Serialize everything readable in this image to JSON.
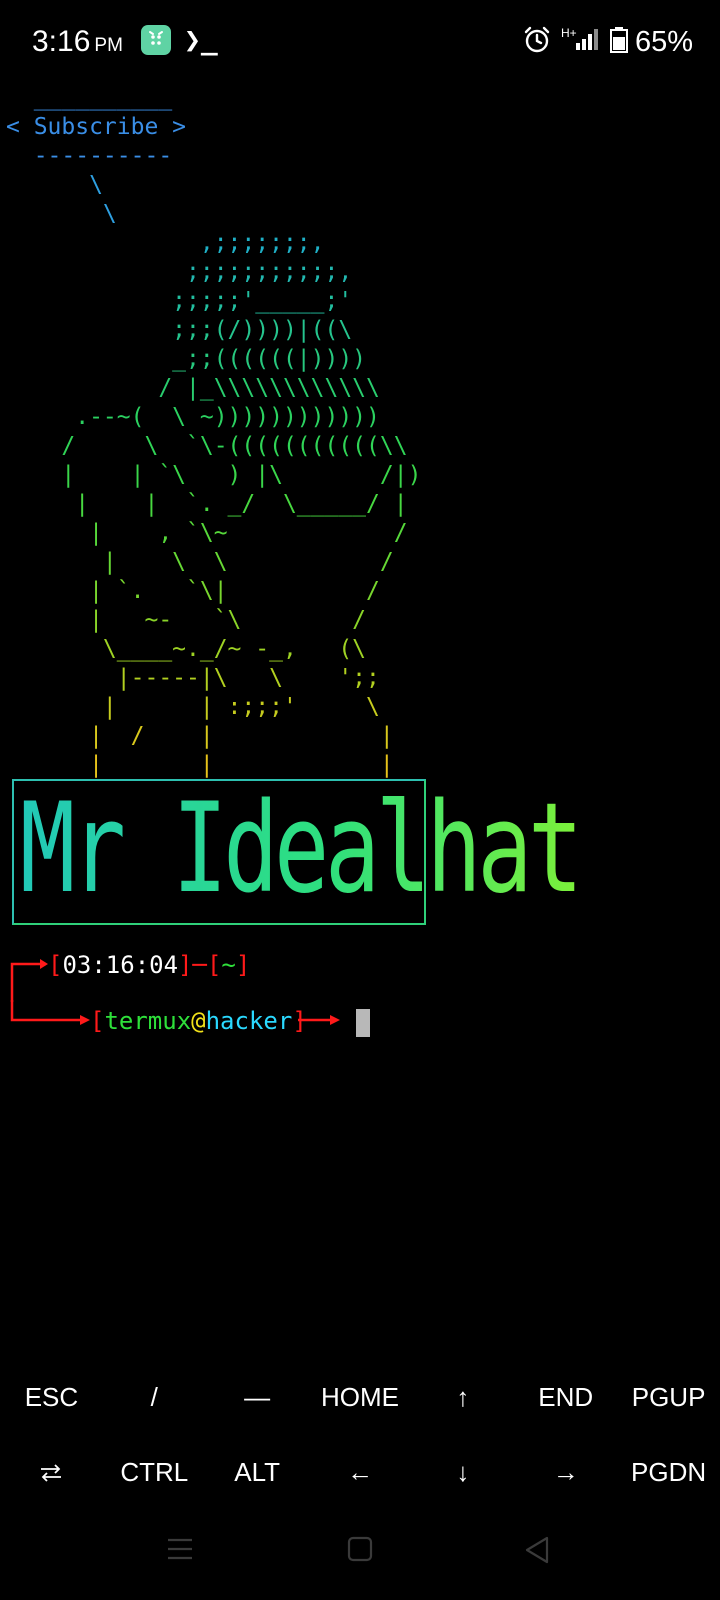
{
  "status_bar": {
    "time": "3:16",
    "ampm": "PM",
    "prompt_glyph": "❯_",
    "network_type": "H+",
    "battery": "65%",
    "icons": [
      "termux-app-icon",
      "terminal-prompt-icon",
      "alarm-icon",
      "signal-icon",
      "battery-icon"
    ]
  },
  "terminal": {
    "ascii_lines": [
      {
        "text": "  __________",
        "color": "#3a8ee6"
      },
      {
        "text": "< Subscribe >",
        "color": "#3a8ee6"
      },
      {
        "text": "  ----------",
        "color": "#3a8ee6"
      },
      {
        "text": "      \\",
        "color": "#2e9fe0"
      },
      {
        "text": "       \\",
        "color": "#2e9fe0"
      },
      {
        "text": "              ,;;;;;;;,",
        "color": "#1fb0c6"
      },
      {
        "text": "             ;;;;;;;;;;;,",
        "color": "#22b8b0"
      },
      {
        "text": "            ;;;;;'_____;'",
        "color": "#22bfa0"
      },
      {
        "text": "            ;;;(/))))|((\\",
        "color": "#25c48e"
      },
      {
        "text": "            _;;((((((|))))",
        "color": "#27c87e"
      },
      {
        "text": "           / |_\\\\\\\\\\\\\\\\\\\\\\\\",
        "color": "#29cd6e"
      },
      {
        "text": "     .--~(  \\ ~))))))))))))",
        "color": "#2bd160"
      },
      {
        "text": "    /     \\  `\\-(((((((((((\\\\",
        "color": "#30d456"
      },
      {
        "text": "    |    | `\\   ) |\\       /|)",
        "color": "#3ad64a"
      },
      {
        "text": "     |    |  `. _/  \\_____/ |",
        "color": "#48d840"
      },
      {
        "text": "      |    , `\\~            /",
        "color": "#56d83a"
      },
      {
        "text": "       |    \\  \\           /",
        "color": "#66d834"
      },
      {
        "text": "      | `.   `\\|          /",
        "color": "#78d62e"
      },
      {
        "text": "      |   ~-   `\\        /",
        "color": "#8ad428"
      },
      {
        "text": "       \\____~._/~ -_,   (\\",
        "color": "#9ed224"
      },
      {
        "text": "        |-----|\\   \\    ';;",
        "color": "#b2d020"
      },
      {
        "text": "       |      | :;;;'     \\",
        "color": "#c6cc1e"
      },
      {
        "text": "      |  /    |            |",
        "color": "#d8c81c"
      },
      {
        "text": "      |       |            |",
        "color": "#e6c21a"
      }
    ],
    "banner": "Mr Idealhat",
    "prompt": {
      "time": "03:16:04",
      "dir": "~",
      "user": "termux",
      "at": "@",
      "host": "hacker"
    }
  },
  "extra_keys": {
    "row1": [
      "ESC",
      "/",
      "—",
      "HOME",
      "↑",
      "END",
      "PGUP"
    ],
    "row2": [
      "⭾",
      "CTRL",
      "ALT",
      "←",
      "↓",
      "→",
      "PGDN"
    ]
  },
  "nav_bar": {
    "icons": [
      "recents-icon",
      "home-icon",
      "back-icon"
    ]
  }
}
